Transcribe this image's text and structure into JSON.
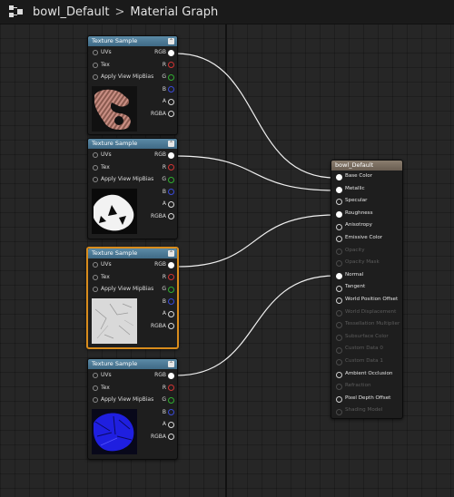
{
  "header": {
    "asset_name": "bowl_Default",
    "graph_name": "Material Graph"
  },
  "texture_nodes": [
    {
      "title": "Texture Sample",
      "inputs": [
        "UVs",
        "Tex",
        "Apply View MipBias"
      ],
      "outputs": [
        "RGB",
        "R",
        "G",
        "B",
        "A",
        "RGBA"
      ],
      "preview": "striped-brown-texture",
      "selected": false
    },
    {
      "title": "Texture Sample",
      "inputs": [
        "UVs",
        "Tex",
        "Apply View MipBias"
      ],
      "outputs": [
        "RGB",
        "R",
        "G",
        "B",
        "A",
        "RGBA"
      ],
      "preview": "white-mask-texture",
      "selected": false
    },
    {
      "title": "Texture Sample",
      "inputs": [
        "UVs",
        "Tex",
        "Apply View MipBias"
      ],
      "outputs": [
        "RGB",
        "R",
        "G",
        "B",
        "A",
        "RGBA"
      ],
      "preview": "gray-scratch-texture",
      "selected": true
    },
    {
      "title": "Texture Sample",
      "inputs": [
        "UVs",
        "Tex",
        "Apply View MipBias"
      ],
      "outputs": [
        "RGB",
        "R",
        "G",
        "B",
        "A",
        "RGBA"
      ],
      "preview": "blue-normal-texture",
      "selected": false
    }
  ],
  "material_node": {
    "title": "bowl_Default",
    "inputs": [
      {
        "label": "Base Color",
        "enabled": true,
        "connected": true
      },
      {
        "label": "Metallic",
        "enabled": true,
        "connected": true
      },
      {
        "label": "Specular",
        "enabled": true,
        "connected": false
      },
      {
        "label": "Roughness",
        "enabled": true,
        "connected": true
      },
      {
        "label": "Anisotropy",
        "enabled": true,
        "connected": false
      },
      {
        "label": "Emissive Color",
        "enabled": true,
        "connected": false
      },
      {
        "label": "Opacity",
        "enabled": false,
        "connected": false
      },
      {
        "label": "Opacity Mask",
        "enabled": false,
        "connected": false
      },
      {
        "label": "Normal",
        "enabled": true,
        "connected": true
      },
      {
        "label": "Tangent",
        "enabled": true,
        "connected": false
      },
      {
        "label": "World Position Offset",
        "enabled": true,
        "connected": false
      },
      {
        "label": "World Displacement",
        "enabled": false,
        "connected": false
      },
      {
        "label": "Tessellation Multiplier",
        "enabled": false,
        "connected": false
      },
      {
        "label": "Subsurface Color",
        "enabled": false,
        "connected": false
      },
      {
        "label": "Custom Data 0",
        "enabled": false,
        "connected": false
      },
      {
        "label": "Custom Data 1",
        "enabled": false,
        "connected": false
      },
      {
        "label": "Ambient Occlusion",
        "enabled": true,
        "connected": false
      },
      {
        "label": "Refraction",
        "enabled": false,
        "connected": false
      },
      {
        "label": "Pixel Depth Offset",
        "enabled": true,
        "connected": false
      },
      {
        "label": "Shading Model",
        "enabled": false,
        "connected": false
      }
    ]
  },
  "connections": [
    {
      "from_node": 0,
      "from_pin": "RGB",
      "to_input": "Base Color"
    },
    {
      "from_node": 1,
      "from_pin": "RGB",
      "to_input": "Metallic"
    },
    {
      "from_node": 2,
      "from_pin": "RGB",
      "to_input": "Roughness"
    },
    {
      "from_node": 3,
      "from_pin": "RGB",
      "to_input": "Normal"
    }
  ],
  "colors": {
    "canvas": "#262626",
    "texture_header": "#4f7d99",
    "material_header": "#7a6e62",
    "selection": "#d98c1c",
    "pin_r": "#d23333",
    "pin_g": "#2fae2f",
    "pin_b": "#3a4ad8"
  }
}
